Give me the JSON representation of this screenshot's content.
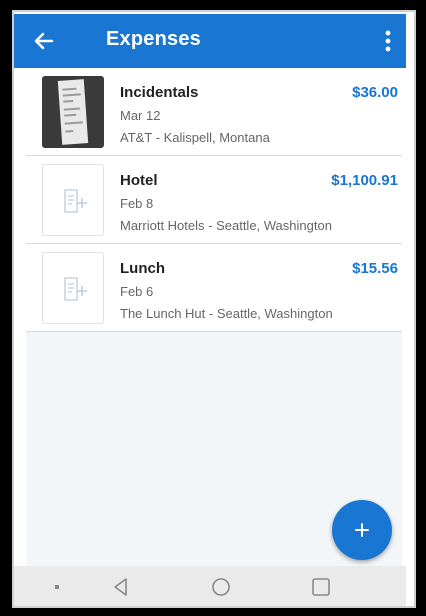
{
  "app_bar": {
    "title": "Expenses",
    "back_icon": "arrow-left-icon",
    "menu_icon": "more-vert-icon",
    "color": "#1976d2"
  },
  "expenses": [
    {
      "name": "Incidentals",
      "amount": "$36.00",
      "date": "Mar 12",
      "vendor": "AT&T - Kalispell, Montana",
      "receipt": "receipt-photo"
    },
    {
      "name": "Hotel",
      "amount": "$1,100.91",
      "date": "Feb 8",
      "vendor": "Marriott Hotels - Seattle, Washington",
      "receipt": "add-receipt-icon"
    },
    {
      "name": "Lunch",
      "amount": "$15.56",
      "date": "Feb 6",
      "vendor": "The Lunch Hut - Seattle, Washington",
      "receipt": "add-receipt-icon"
    }
  ],
  "fab": {
    "icon": "plus-icon"
  },
  "nav_bar": {
    "items": [
      "menu-dot-icon",
      "back-triangle-icon",
      "home-circle-icon",
      "recents-square-icon"
    ]
  },
  "colors": {
    "accent": "#1976d2",
    "amount": "#1976d2",
    "list_bg": "#f3f6f9"
  }
}
